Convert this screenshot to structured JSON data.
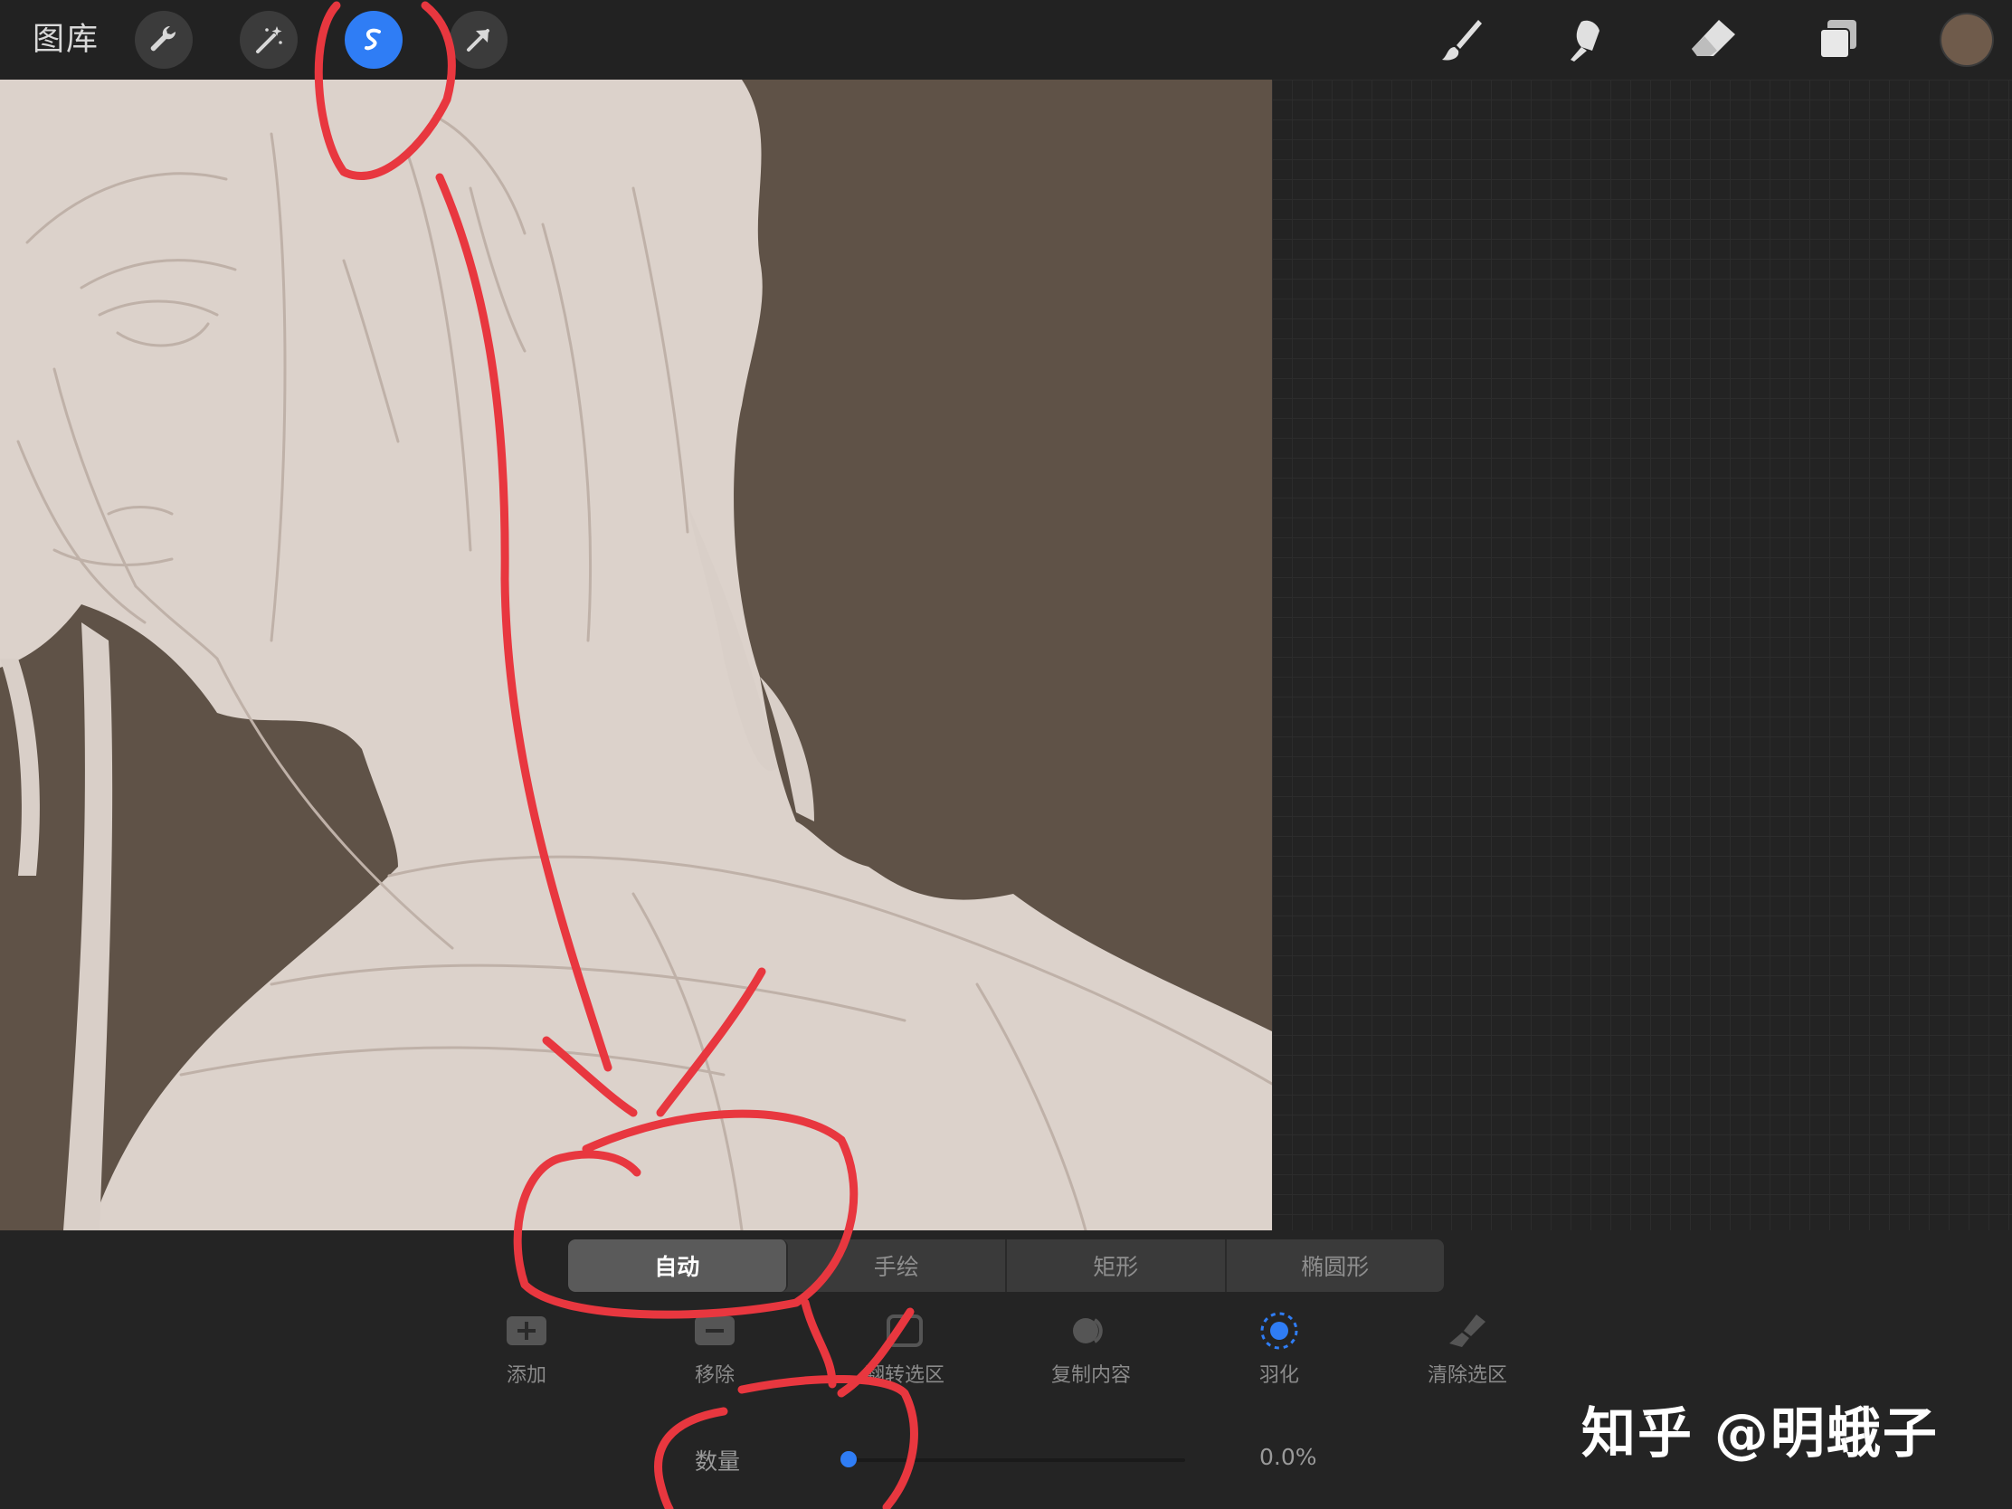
{
  "toolbar": {
    "gallery_label": "图库",
    "left_tools": [
      {
        "icon": "wrench-icon",
        "state": "inactive"
      },
      {
        "icon": "magic-wand-icon",
        "state": "inactive"
      },
      {
        "icon": "selection-icon",
        "state": "active"
      },
      {
        "icon": "transform-arrow-icon",
        "state": "inactive"
      }
    ],
    "right_tools": [
      "brush-icon",
      "smudge-icon",
      "eraser-icon",
      "layers-icon"
    ],
    "current_color": "#6f5b4b",
    "accent_color": "#2f7df5"
  },
  "selection_modes": {
    "active": "自动",
    "items": [
      "自动",
      "手绘",
      "矩形",
      "椭圆形"
    ]
  },
  "actions": [
    {
      "label": "添加",
      "icon": "plus-square-icon"
    },
    {
      "label": "移除",
      "icon": "minus-square-icon"
    },
    {
      "label": "翻转选区",
      "icon": "invert-selection-icon"
    },
    {
      "label": "复制内容",
      "icon": "copy-content-icon"
    },
    {
      "label": "羽化",
      "icon": "feather-icon"
    },
    {
      "label": "清除选区",
      "icon": "clear-selection-icon"
    }
  ],
  "slider": {
    "label": "数量",
    "value_text": "0.0%",
    "value": 0.0
  },
  "watermark": "知乎 @明蛾子"
}
